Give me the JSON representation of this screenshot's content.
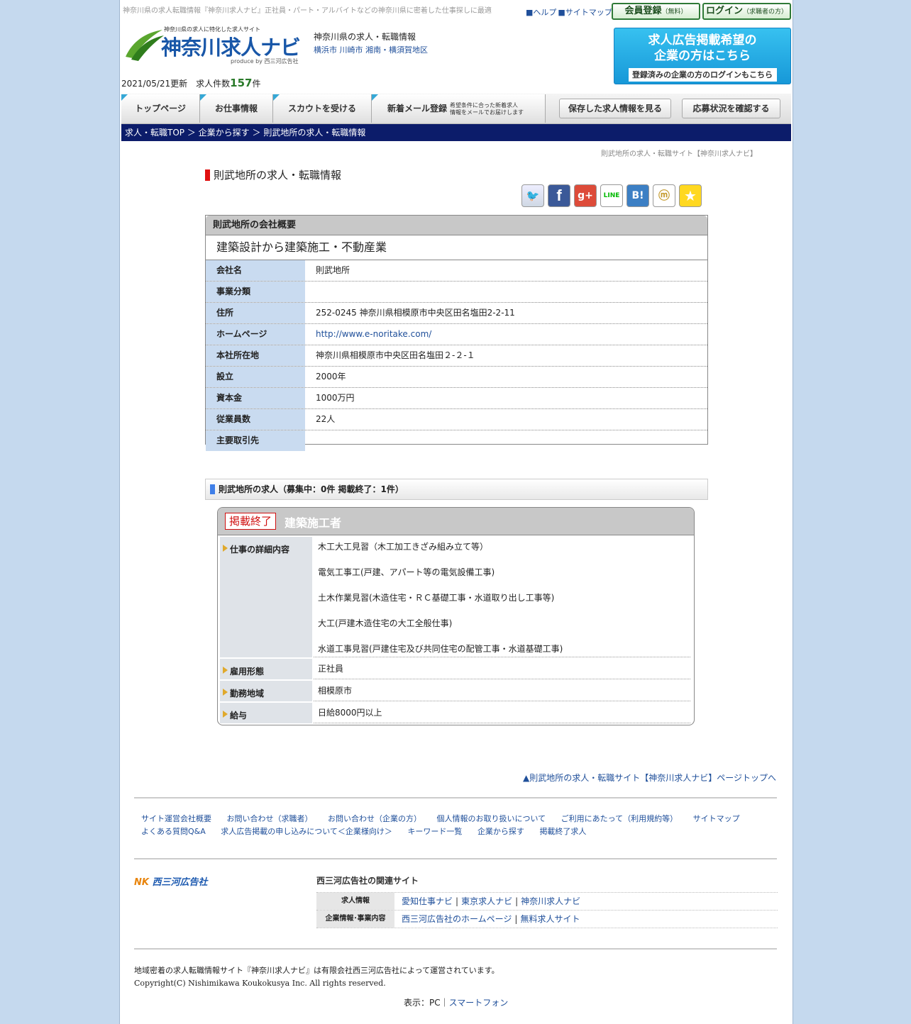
{
  "header": {
    "seo_text": "神奈川県の求人転職情報『神奈川求人ナビ』正社員・パート・アルバイトなどの神奈川県に密着した仕事探しに最適",
    "help": "■ヘルプ",
    "sitemap": "■サイトマップ",
    "register_label": "会員登録",
    "register_sub": "（無料）",
    "login_label": "ログイン",
    "login_sub": "（求職者の方）",
    "logo_tagline": "神奈川県の求人に特化した求人サイト",
    "logo_text": "神奈川求人ナビ",
    "logo_produce": "produce by 西三河広告社",
    "region_title": "神奈川県の求人・転職情報",
    "region_links": [
      "横浜市",
      "川崎市",
      "湘南・横須賀地区"
    ],
    "banner_line1": "求人広告掲載希望の",
    "banner_line2": "企業の方はこちら",
    "banner_sub": "登録済みの企業の方のログインもこちら",
    "updated": "2021/05/21更新　求人件数",
    "job_count": "157",
    "job_count_unit": "件"
  },
  "nav": {
    "items": [
      "トップページ",
      "お仕事情報",
      "スカウトを受ける",
      "新着メール登録"
    ],
    "mail_sub": "希望条件に合った新着求人\n情報をメールでお届けします",
    "saved": "保存した求人情報を見る",
    "status": "応募状況を確認する"
  },
  "breadcrumb": [
    "求人・転職TOP",
    "企業から探す",
    "則武地所の求人・転職情報"
  ],
  "site_name": "則武地所の求人・転職サイト【神奈川求人ナビ】",
  "page_title": "則武地所の求人・転職情報",
  "share": [
    "twitter",
    "facebook",
    "google-plus",
    "line",
    "hatena",
    "mixi",
    "favorite"
  ],
  "overview": {
    "heading": "則武地所の会社概要",
    "catch": "建築設計から建築施工・不動産業",
    "rows": [
      {
        "label": "会社名",
        "value": "則武地所"
      },
      {
        "label": "事業分類",
        "value": ""
      },
      {
        "label": "住所",
        "value": "252-0245 神奈川県相模原市中央区田名塩田2-2-11"
      },
      {
        "label": "ホームページ",
        "value": "http://www.e-noritake.com/"
      },
      {
        "label": "本社所在地",
        "value": "神奈川県相模原市中央区田名塩田２-２-１"
      },
      {
        "label": "設立",
        "value": "2000年"
      },
      {
        "label": "資本金",
        "value": "1000万円"
      },
      {
        "label": "従業員数",
        "value": "22人"
      },
      {
        "label": "主要取引先",
        "value": ""
      }
    ]
  },
  "jobs": {
    "heading": "則武地所の求人（募集中：0件 掲載終了：1件）",
    "job": {
      "badge": "掲載終了",
      "title": "建築施工者",
      "detail_label": "仕事の詳細内容",
      "detail": "木工大工見習（木工加工きざみ組み立て等）\n電気工事工(戸建、アパート等の電気設備工事)\n土木作業見習(木造住宅・ＲＣ基礎工事・水道取り出し工事等)\n大工(戸建木造住宅の大工全般仕事)\n水道工事見習(戸建住宅及び共同住宅の配管工事・水道基礎工事)",
      "employment_label": "雇用形態",
      "employment": "正社員",
      "location_label": "勤務地域",
      "location": "相模原市",
      "salary_label": "給与",
      "salary": "日給8000円以上"
    }
  },
  "pagetop": "▲則武地所の求人・転職サイト【神奈川求人ナビ】ページトップへ",
  "footer": {
    "links_row1": [
      "サイト運営会社概要",
      "お問い合わせ（求職者）",
      "お問い合わせ（企業の方）",
      "個人情報のお取り扱いについて",
      "ご利用にあたって（利用規約等）",
      "サイトマップ"
    ],
    "links_row2": [
      "よくある質問Q&A",
      "求人広告掲載の申し込みについて＜企業様向け＞",
      "キーワード一覧",
      "企業から探す",
      "掲載終了求人"
    ],
    "company_logo": "西三河広告社",
    "related_title": "西三河広告社の関連サイト",
    "related": [
      {
        "label": "求人情報",
        "links": [
          "愛知仕事ナビ",
          "東京求人ナビ",
          "神奈川求人ナビ"
        ]
      },
      {
        "label": "企業情報･事業内容",
        "links": [
          "西三河広告社のホームページ",
          "無料求人サイト"
        ]
      }
    ],
    "copy1": "地域密着の求人転職情報サイト『神奈川求人ナビ』は有限会社西三河広告社によって運営されています。",
    "copy2": "Copyright(C) Nishimikawa Koukokusya Inc. All rights reserved.",
    "display_label": "表示：PC｜",
    "smartphone": "スマートフォン"
  }
}
